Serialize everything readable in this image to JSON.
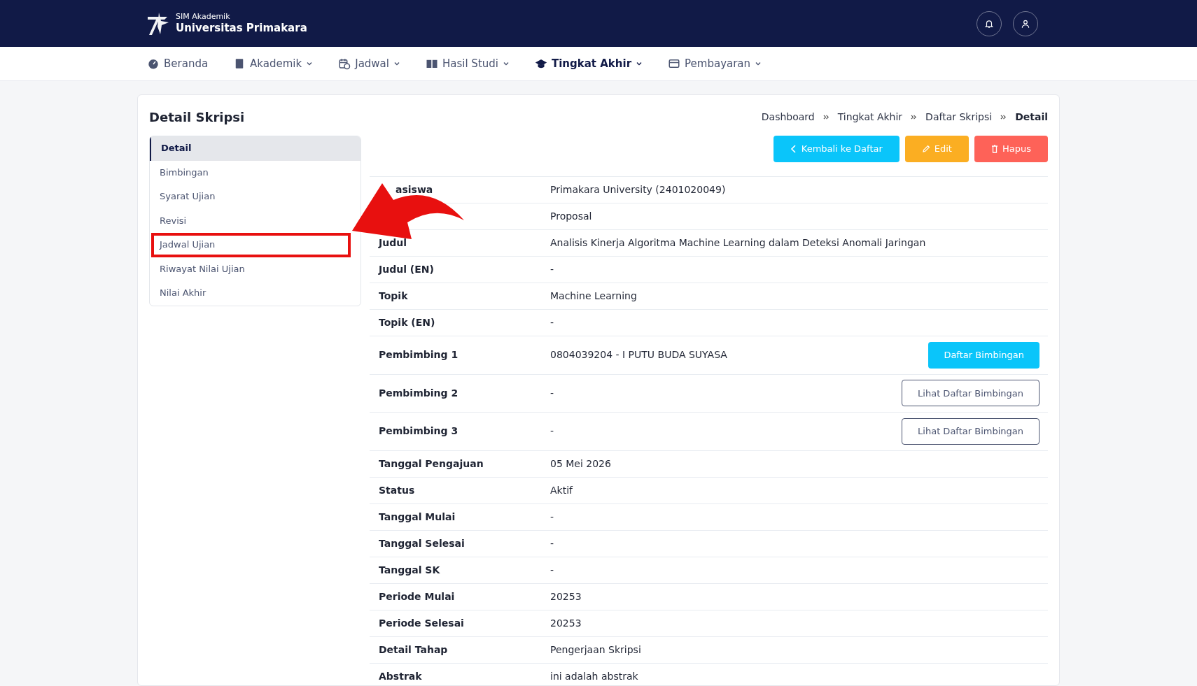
{
  "brand": {
    "subtitle": "SIM Akademik",
    "title": "Universitas Primakara"
  },
  "nav": [
    {
      "label": "Beranda",
      "dropdown": false,
      "selected": false
    },
    {
      "label": "Akademik",
      "dropdown": true,
      "selected": false
    },
    {
      "label": "Jadwal",
      "dropdown": true,
      "selected": false
    },
    {
      "label": "Hasil Studi",
      "dropdown": true,
      "selected": false
    },
    {
      "label": "Tingkat Akhir",
      "dropdown": true,
      "selected": true
    },
    {
      "label": "Pembayaran",
      "dropdown": true,
      "selected": false
    }
  ],
  "page_title": "Detail Skripsi",
  "breadcrumb": [
    {
      "label": "Dashboard",
      "current": false
    },
    {
      "label": "Tingkat Akhir",
      "current": false
    },
    {
      "label": "Daftar Skripsi",
      "current": false
    },
    {
      "label": "Detail",
      "current": true
    }
  ],
  "sidebar": [
    {
      "label": "Detail",
      "selected": true,
      "highlighted": false
    },
    {
      "label": "Bimbingan",
      "selected": false,
      "highlighted": false
    },
    {
      "label": "Syarat Ujian",
      "selected": false,
      "highlighted": false
    },
    {
      "label": "Revisi",
      "selected": false,
      "highlighted": false
    },
    {
      "label": "Jadwal Ujian",
      "selected": false,
      "highlighted": true
    },
    {
      "label": "Riwayat Nilai Ujian",
      "selected": false,
      "highlighted": false
    },
    {
      "label": "Nilai Akhir",
      "selected": false,
      "highlighted": false
    }
  ],
  "actions": [
    {
      "label": "Kembali ke Daftar",
      "kind": "back"
    },
    {
      "label": "Edit",
      "kind": "edit"
    },
    {
      "label": "Hapus",
      "kind": "delete"
    }
  ],
  "rows": [
    {
      "label": "asiswa",
      "value": "Primakara University (2401020049)"
    },
    {
      "value": "Proposal"
    },
    {
      "label": "Judul",
      "value": "Analisis Kinerja Algoritma Machine Learning dalam Deteksi Anomali Jaringan"
    },
    {
      "label": "Judul (EN)",
      "value": "-"
    },
    {
      "label": "Topik",
      "value": "Machine Learning"
    },
    {
      "label": "Topik (EN)",
      "value": "-"
    },
    {
      "label": "Pembimbing 1",
      "value": "0804039204 - I PUTU BUDA SUYASA",
      "button": {
        "label": "Daftar Bimbingan",
        "kind": "primary"
      }
    },
    {
      "label": "Pembimbing 2",
      "value": "-",
      "button": {
        "label": "Lihat Daftar Bimbingan",
        "kind": "outline"
      }
    },
    {
      "label": "Pembimbing 3",
      "value": "-",
      "button": {
        "label": "Lihat Daftar Bimbingan",
        "kind": "outline"
      }
    },
    {
      "label": "Tanggal Pengajuan",
      "value": "05 Mei 2026"
    },
    {
      "label": "Status",
      "value": "Aktif"
    },
    {
      "label": "Tanggal Mulai",
      "value": "-"
    },
    {
      "label": "Tanggal Selesai",
      "value": "-"
    },
    {
      "label": "Tanggal SK",
      "value": "-"
    },
    {
      "label": "Periode Mulai",
      "value": "20253"
    },
    {
      "label": "Periode Selesai",
      "value": "20253"
    },
    {
      "label": "Detail Tahap",
      "value": "Pengerjaan Skripsi"
    },
    {
      "label": "Abstrak",
      "value": "ini adalah abstrak"
    }
  ]
}
